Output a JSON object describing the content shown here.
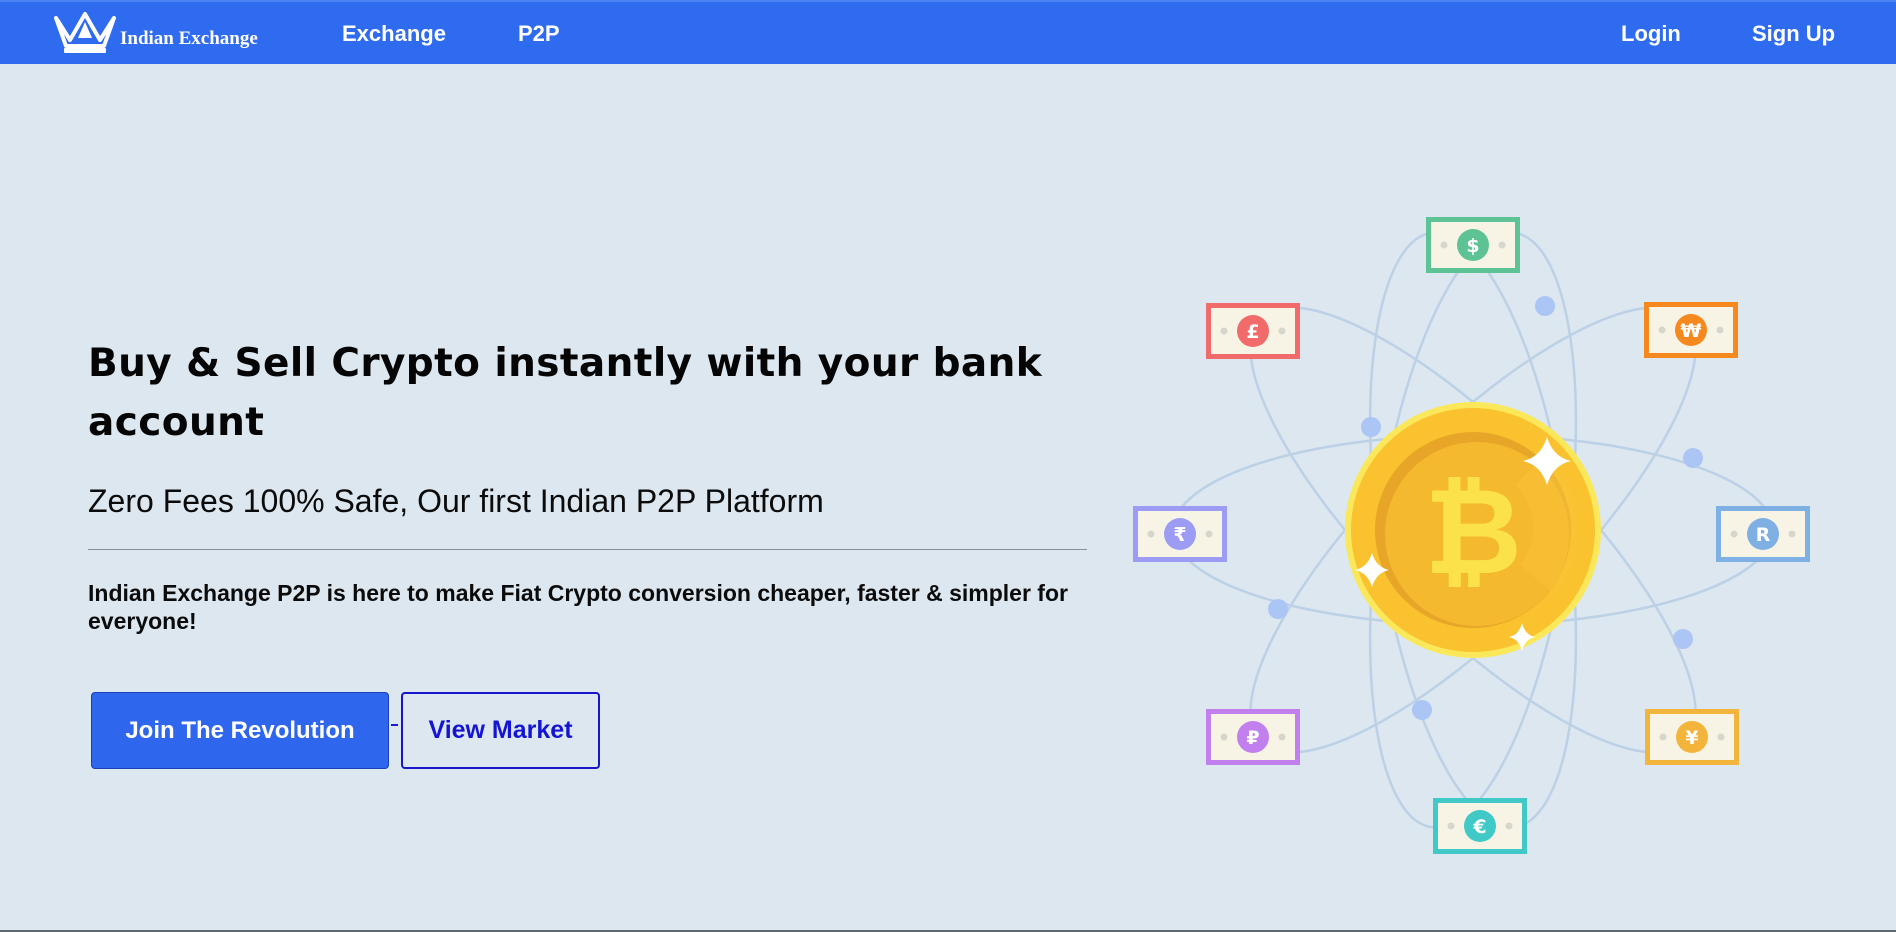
{
  "nav": {
    "brand": "Indian Exchange",
    "links": [
      "Exchange",
      "P2P"
    ],
    "login": "Login",
    "signup": "Sign Up"
  },
  "hero": {
    "title": "Buy & Sell Crypto instantly with your bank account",
    "subtitle": "Zero Fees 100% Safe, Our first Indian P2P Platform",
    "description": "Indian Exchange P2P is here to make Fiat Crypto conversion cheaper, faster & simpler for everyone!",
    "primary_button": "Join The Revolution",
    "secondary_button": "View Market"
  },
  "illustration": {
    "center_symbol": "₿",
    "currency_notes": [
      {
        "symbol": "$",
        "color": "#5dc394"
      },
      {
        "symbol": "£",
        "color": "#f26b6b"
      },
      {
        "symbol": "₩",
        "color": "#f5891e"
      },
      {
        "symbol": "₹",
        "color": "#9c9cf4"
      },
      {
        "symbol": "R",
        "color": "#7fb0e3"
      },
      {
        "symbol": "₽",
        "color": "#c27fee"
      },
      {
        "symbol": "¥",
        "color": "#f3b43b"
      },
      {
        "symbol": "€",
        "color": "#40c9c6"
      }
    ]
  },
  "colors": {
    "nav_background": "#2f6bef",
    "page_background": "#dce7f0",
    "primary_button": "#2f66ee",
    "secondary_button_text": "#1414d4",
    "coin": "#f9c22e"
  }
}
